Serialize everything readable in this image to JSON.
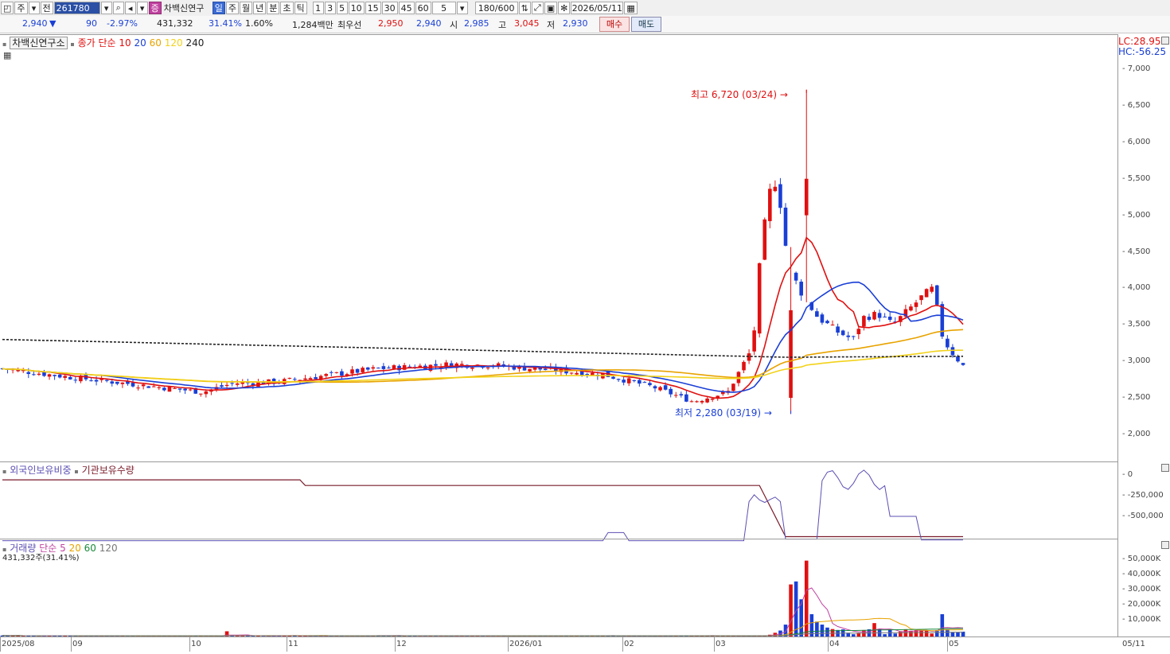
{
  "toolbar": {
    "market_label": "주",
    "type_label": "전",
    "code": "261780",
    "stock_badge": "증",
    "stock_name": "차백신연구",
    "periods": [
      "일",
      "주",
      "월",
      "년",
      "분",
      "초",
      "틱"
    ],
    "selected_period": "일",
    "intervals": [
      "1",
      "3",
      "5",
      "10",
      "15",
      "30",
      "45",
      "60"
    ],
    "custom_interval": "5",
    "count": "180",
    "count_total": "/600",
    "date": "2026/05/11"
  },
  "quote": {
    "price": "2,940",
    "change": "90",
    "change_pct": "-2.97%",
    "volume": "431,332",
    "vol_ratio": "31.41%",
    "turnover_pct": "1.60%",
    "amount": "1,284백만",
    "best_bid_label": "최우선",
    "best_ask": "2,950",
    "best_bid": "2,940",
    "open_label": "시",
    "open": "2,985",
    "high_label": "고",
    "high": "3,045",
    "low_label": "저",
    "low": "2,930",
    "buy_label": "매수",
    "sell_label": "매도"
  },
  "price_legend": {
    "name": "차백신연구소",
    "title": "종가 단순",
    "ma": [
      "10",
      "20",
      "60",
      "120",
      "240"
    ],
    "lc": "LC:28.95",
    "hc": "HC:-56.25"
  },
  "annotations": {
    "high": "최고 6,720 (03/24)",
    "low": "최저 2,280 (03/19)"
  },
  "price_axis": [
    "7,000",
    "6,500",
    "6,000",
    "5,500",
    "5,000",
    "4,500",
    "4,000",
    "3,500",
    "3,000",
    "2,500",
    "2,000"
  ],
  "holding_legend": {
    "foreign": "외국인보유비중",
    "institution": "기관보유수량"
  },
  "holding_axis": [
    "0",
    "-250,000",
    "-500,000"
  ],
  "volume_legend": {
    "title": "거래량",
    "ma_label": "단순 5",
    "ma": [
      "20",
      "60",
      "120"
    ],
    "current": "431,332주(31.41%)"
  },
  "volume_axis": [
    "50,000K",
    "40,000K",
    "30,000K",
    "20,000K",
    "10,000K"
  ],
  "x_axis": [
    "2025/08",
    "09",
    "10",
    "11",
    "12",
    "2026/01",
    "02",
    "03",
    "04",
    "05"
  ],
  "x_axis_right": "05/11",
  "colors": {
    "up": "#e01010",
    "down": "#1a3fd6",
    "ma10": "#e01010",
    "ma20": "#1a3fd6",
    "ma60": "#e8a300",
    "ma120": "#f2d21a",
    "ma240": "#222222",
    "foreign": "#5b4fb3",
    "institution": "#7a1c2a"
  },
  "chart_data": [
    {
      "type": "candlestick",
      "title": "차백신연구소",
      "ylim": [
        1700,
        7300
      ],
      "x_range": [
        "2025/08",
        "2026/05/11"
      ],
      "annotated_high": {
        "date": "03/24",
        "value": 6720
      },
      "annotated_low": {
        "date": "03/19",
        "value": 2280
      },
      "close_path": [
        {
          "date": "2025/08",
          "close": 2900
        },
        {
          "date": "2025/09",
          "close": 2750
        },
        {
          "date": "2025/10",
          "close": 2600
        },
        {
          "date": "2025/10/20",
          "close": 2700
        },
        {
          "date": "2025/11",
          "close": 2750
        },
        {
          "date": "2025/12",
          "close": 2900
        },
        {
          "date": "2025/12/20",
          "close": 2980
        },
        {
          "date": "2026/01",
          "close": 2950
        },
        {
          "date": "2026/02",
          "close": 2850
        },
        {
          "date": "2026/03",
          "close": 2550
        },
        {
          "date": "2026/03/19",
          "close": 2350
        },
        {
          "date": "2026/03/24",
          "close": 5500
        },
        {
          "date": "2026/03/27",
          "close": 4300
        },
        {
          "date": "2026/04",
          "close": 3600
        },
        {
          "date": "2026/04/20",
          "close": 3500
        },
        {
          "date": "2026/05",
          "close": 3900
        },
        {
          "date": "2026/05/11",
          "close": 2940
        }
      ],
      "moving_averages": [
        "10",
        "20",
        "60",
        "120",
        "240"
      ]
    },
    {
      "type": "line",
      "title": "기관보유수량",
      "series": [
        {
          "name": "외국인보유비중",
          "shape": "near zero most of the period, spikes in 03-04"
        },
        {
          "name": "기관보유수량",
          "values_k": [
            -50,
            -50,
            -120,
            -120,
            -120,
            -120,
            -120,
            -120,
            -750,
            -750,
            -750
          ]
        }
      ],
      "ylim": [
        -800000,
        50000
      ]
    },
    {
      "type": "bar",
      "title": "거래량",
      "unit": "K",
      "peaks": [
        {
          "date": "2026/03/20",
          "value": 35000
        },
        {
          "date": "2026/03/23",
          "value": 37000
        },
        {
          "date": "2026/03/24",
          "value": 51000
        },
        {
          "date": "2026/05/04",
          "value": 15000
        }
      ],
      "ylim": [
        0,
        60000
      ]
    }
  ]
}
